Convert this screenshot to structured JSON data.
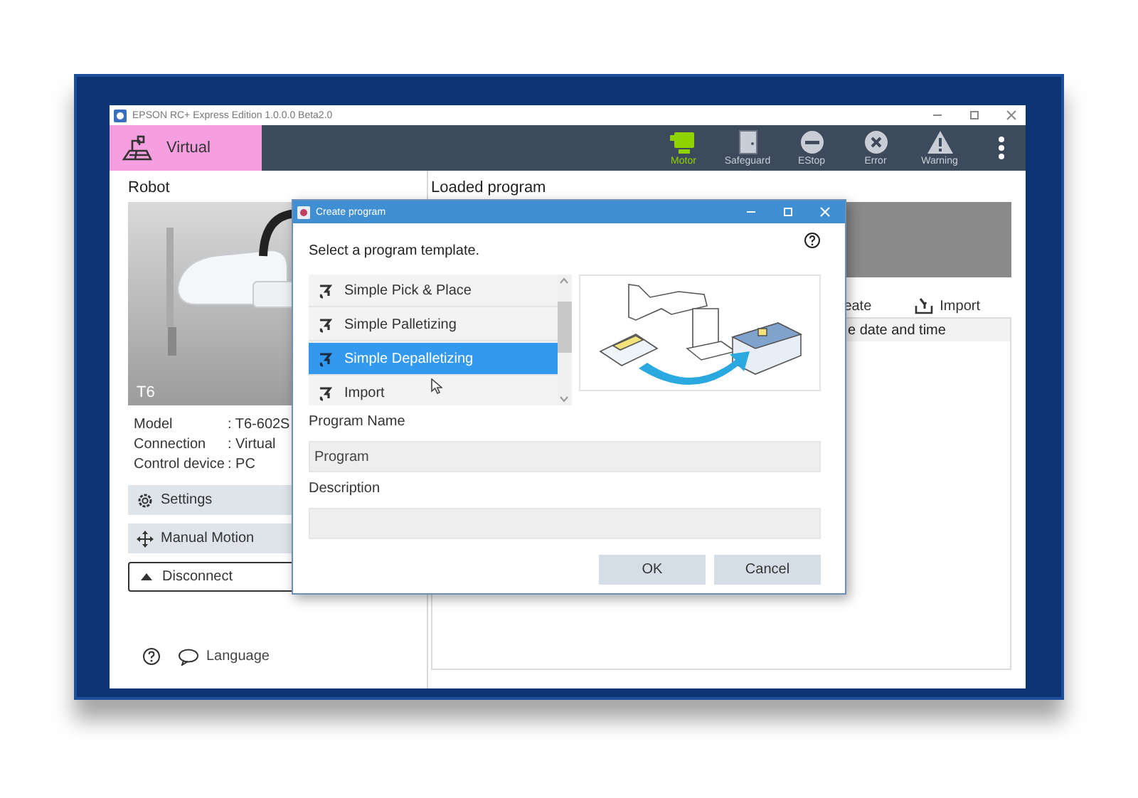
{
  "window": {
    "title": "EPSON RC+ Express Edition 1.0.0.0 Beta2.0"
  },
  "header": {
    "mode": {
      "label": "Virtual"
    },
    "indicators": [
      {
        "label": "Motor",
        "kind": "motor",
        "on": true
      },
      {
        "label": "Safeguard",
        "kind": "safeguard",
        "on": false
      },
      {
        "label": "EStop",
        "kind": "estop",
        "on": false
      },
      {
        "label": "Error",
        "kind": "error",
        "on": false
      },
      {
        "label": "Warning",
        "kind": "warning",
        "on": false
      }
    ]
  },
  "robot_panel": {
    "title": "Robot",
    "picture": {
      "kind": "picture",
      "caption": "T6"
    },
    "info": [
      {
        "label": "Model",
        "value": ": T6-602S"
      },
      {
        "label": "Connection",
        "value": ": Virtual"
      },
      {
        "label": "Control device",
        "value": ": PC"
      }
    ],
    "buttons": [
      {
        "label": "Settings",
        "kind": "settings"
      },
      {
        "label": "Manual Motion",
        "kind": "move"
      },
      {
        "label": "Disconnect",
        "kind": "eject"
      }
    ],
    "language": "Language"
  },
  "program_panel": {
    "title": "Loaded program",
    "actions": [
      {
        "label": "eate",
        "kind": "plain"
      },
      {
        "label": "Import",
        "kind": "import"
      }
    ],
    "columns": [
      "e date and time"
    ]
  },
  "dialog": {
    "title": "Create program",
    "prompt": "Select a program template.",
    "templates": [
      {
        "label": "Simple Pick & Place",
        "selected": false
      },
      {
        "label": "Simple Palletizing",
        "selected": false
      },
      {
        "label": "Simple Depalletizing",
        "selected": true
      },
      {
        "label": "Import",
        "selected": false
      }
    ],
    "fields": [
      {
        "label": "Program Name",
        "value": "Program"
      },
      {
        "label": "Description"
      }
    ],
    "buttons": [
      "OK",
      "Cancel"
    ]
  }
}
